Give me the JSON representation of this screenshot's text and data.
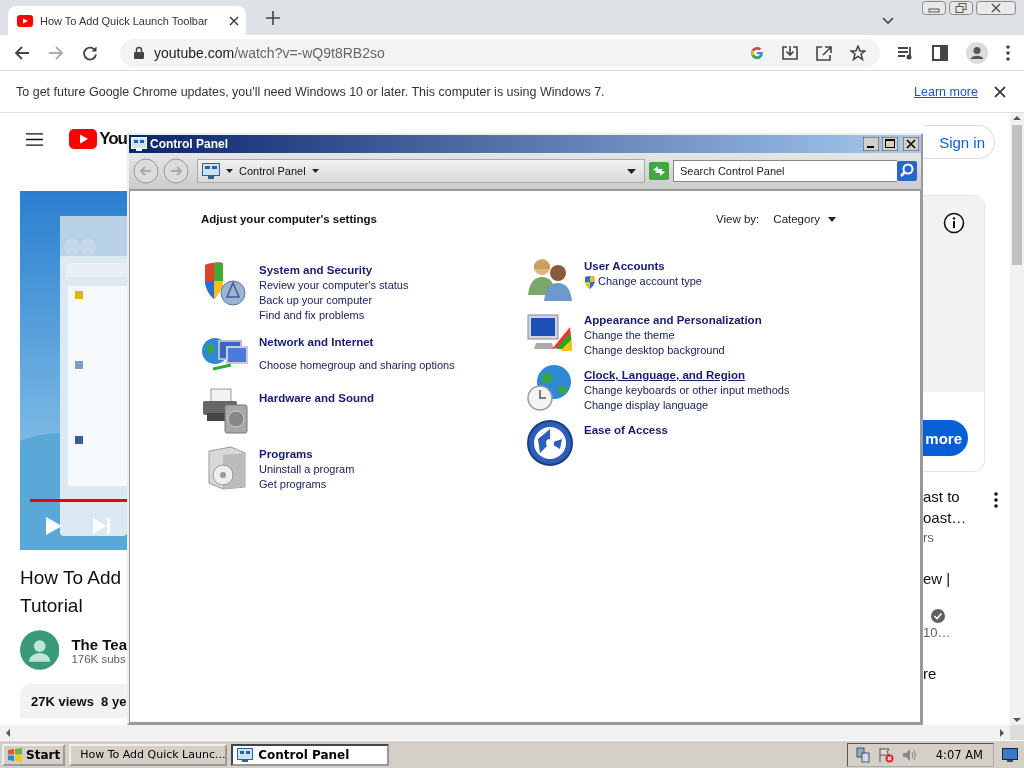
{
  "browser": {
    "tabs": [
      {
        "title": "How To Add Quick Launch Toolbar",
        "selected": true
      }
    ],
    "address": {
      "host": "youtube.com",
      "path": "/watch?v=-wQ9t8RB2so"
    },
    "infobar": {
      "message": "To get future Google Chrome updates, you'll need Windows 10 or later. This computer is using Windows 7.",
      "link": "Learn more"
    }
  },
  "page": {
    "logo": "You",
    "sign_in": "Sign in",
    "video": {
      "kind": "picture"
    },
    "title_lines": [
      "How To Add",
      "Tutorial"
    ],
    "channel": "The Tea",
    "subscribers": "176K subs",
    "stats": "27K views  8 ye",
    "ad_button": "more",
    "side_texts": [
      {
        "text": "ast to",
        "kind": "title"
      },
      {
        "text": "oast…",
        "kind": "title"
      },
      {
        "text": "rs",
        "kind": "meta"
      },
      {
        "text": "ew |",
        "kind": "title-start"
      },
      {
        "text": "10…",
        "kind": "verified-meta"
      },
      {
        "text": "re",
        "kind": "title-start"
      }
    ]
  },
  "control_panel": {
    "title": "Control Panel",
    "breadcrumb": "Control Panel",
    "search": {
      "placeholder": "Search Control Panel"
    },
    "heading": "Adjust your computer's settings",
    "view_by": {
      "label": "View by:",
      "value": "Category"
    },
    "columns": [
      [
        {
          "title": "System and Security",
          "hovered": false,
          "links": [
            {
              "text": "Review your computer's status",
              "shield": false
            },
            {
              "text": "Back up your computer",
              "shield": false
            },
            {
              "text": "Find and fix problems",
              "shield": false
            }
          ]
        },
        {
          "title": "Network and Internet",
          "hovered": false,
          "links": [
            {
              "text": "Choose homegroup and sharing options",
              "shield": false
            }
          ]
        },
        {
          "title": "Hardware and Sound",
          "hovered": false
        },
        {
          "title": "Programs",
          "hovered": false,
          "links": [
            {
              "text": "Uninstall a program",
              "shield": false
            },
            {
              "text": "Get programs",
              "shield": false
            }
          ]
        }
      ],
      [
        {
          "title": "User Accounts",
          "hovered": false,
          "links": [
            {
              "text": "Change account type",
              "shield": true
            }
          ]
        },
        {
          "title": "Appearance and Personalization",
          "hovered": false,
          "links": [
            {
              "text": "Change the theme",
              "shield": false
            },
            {
              "text": "Change desktop background",
              "shield": false
            }
          ]
        },
        {
          "title": "Clock, Language, and Region",
          "hovered": true,
          "links": [
            {
              "text": "Change keyboards or other input methods",
              "shield": false
            },
            {
              "text": "Change display language",
              "shield": false
            }
          ]
        },
        {
          "title": "Ease of Access",
          "hovered": false
        }
      ]
    ]
  },
  "taskbar": {
    "start": "Start",
    "tasks": [
      {
        "label": "How To Add Quick Launc...",
        "selected": false
      },
      {
        "label": "Control Panel",
        "selected": true
      }
    ],
    "clock": "4:07 AM"
  }
}
